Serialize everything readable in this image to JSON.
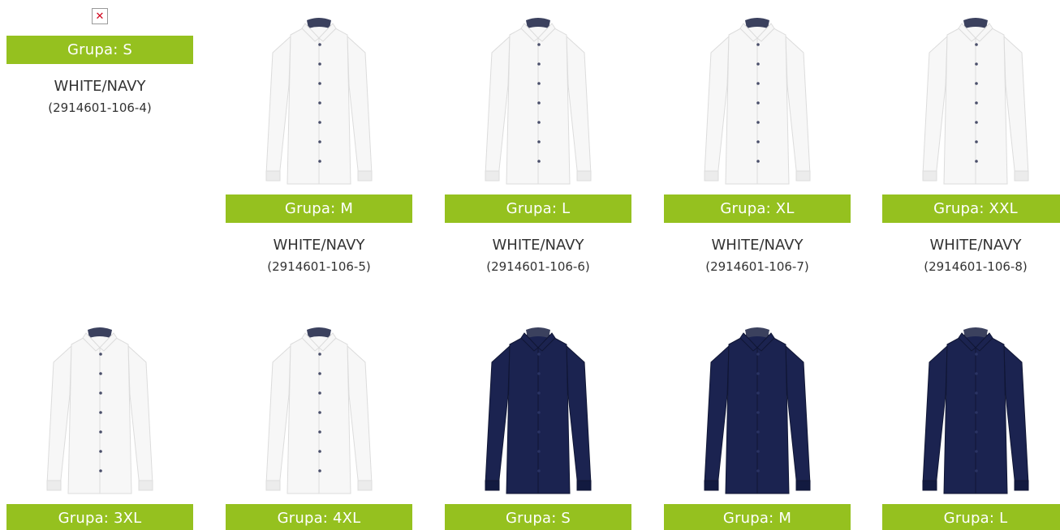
{
  "colors": {
    "badge_green": "#95c11f",
    "white_shirt": "#f7f7f7",
    "navy_shirt": "#1b2350",
    "text": "#333333"
  },
  "broken_image_icon": "close-icon",
  "products": [
    {
      "group": "Grupa: S",
      "color": "WHITE/NAVY",
      "code": "(2914601-106-4)",
      "shirt": "white",
      "image_broken": true
    },
    {
      "group": "Grupa: M",
      "color": "WHITE/NAVY",
      "code": "(2914601-106-5)",
      "shirt": "white"
    },
    {
      "group": "Grupa: L",
      "color": "WHITE/NAVY",
      "code": "(2914601-106-6)",
      "shirt": "white"
    },
    {
      "group": "Grupa: XL",
      "color": "WHITE/NAVY",
      "code": "(2914601-106-7)",
      "shirt": "white"
    },
    {
      "group": "Grupa: XXL",
      "color": "WHITE/NAVY",
      "code": "(2914601-106-8)",
      "shirt": "white"
    },
    {
      "group": "Grupa: 3XL",
      "shirt": "white"
    },
    {
      "group": "Grupa: 4XL",
      "shirt": "white"
    },
    {
      "group": "Grupa: S",
      "shirt": "navy"
    },
    {
      "group": "Grupa: M",
      "shirt": "navy"
    },
    {
      "group": "Grupa: L",
      "shirt": "navy"
    }
  ]
}
